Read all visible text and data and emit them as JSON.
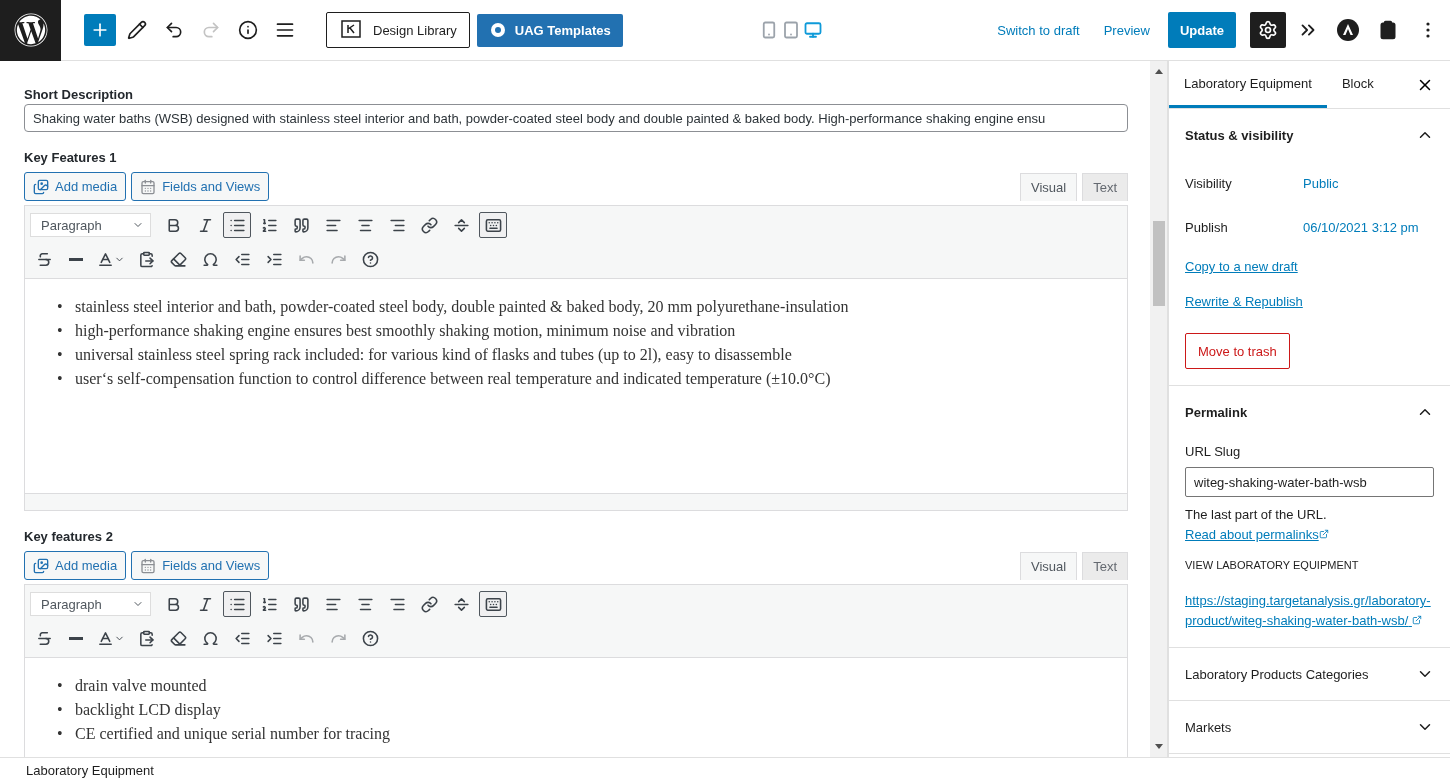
{
  "top_bar": {
    "tools": [
      {
        "kind": "add",
        "disabled": false
      },
      {
        "kind": "edit",
        "disabled": false
      },
      {
        "kind": "undo",
        "disabled": false
      },
      {
        "kind": "redo",
        "disabled": true
      },
      {
        "kind": "info",
        "disabled": false
      },
      {
        "kind": "list-view",
        "disabled": false
      }
    ],
    "design_library": "Design Library",
    "uag_templates": "UAG Templates",
    "preview_devices": [
      {
        "kind": "mobile",
        "selected": false
      },
      {
        "kind": "tablet",
        "selected": false
      },
      {
        "kind": "desktop",
        "selected": true
      }
    ],
    "switch_to_draft": "Switch to draft",
    "preview": "Preview",
    "update": "Update",
    "plugins": [
      {
        "kind": "settings",
        "selected": true
      },
      {
        "kind": "spectra",
        "selected": false
      },
      {
        "kind": "astra",
        "selected": false
      },
      {
        "kind": "clipboard",
        "selected": false
      },
      {
        "kind": "more",
        "selected": false
      }
    ]
  },
  "short_description": {
    "label": "Short Description",
    "value": "Shaking water baths (WSB) designed with stainless steel interior and bath, powder-coated steel body and double painted & baked body. High-performance shaking engine ensu"
  },
  "editors": [
    {
      "label": "Key Features 1",
      "marker": "•",
      "buttons": [
        "Add media",
        "Fields and Views"
      ],
      "tabs": [
        {
          "label": "Visual",
          "selected": true
        },
        {
          "label": "Text",
          "selected": false
        }
      ],
      "format": "Paragraph",
      "toolbar_rows": [
        [
          {
            "kind": "bold",
            "pressed": false,
            "disabled": false
          },
          {
            "kind": "italic",
            "pressed": false,
            "disabled": false
          },
          {
            "kind": "bullets",
            "pressed": true,
            "disabled": false
          },
          {
            "kind": "numbers",
            "pressed": false,
            "disabled": false
          },
          {
            "kind": "quote",
            "pressed": false,
            "disabled": false
          },
          {
            "kind": "align-left",
            "pressed": false,
            "disabled": false
          },
          {
            "kind": "align-center",
            "pressed": false,
            "disabled": false
          },
          {
            "kind": "align-right",
            "pressed": false,
            "disabled": false
          },
          {
            "kind": "link",
            "pressed": false,
            "disabled": false
          },
          {
            "kind": "more",
            "pressed": false,
            "disabled": false
          },
          {
            "kind": "toolbar-toggle",
            "pressed": true,
            "disabled": false
          }
        ],
        [
          {
            "kind": "strike",
            "pressed": false,
            "disabled": false
          },
          {
            "kind": "hr",
            "pressed": false,
            "disabled": false
          },
          {
            "kind": "text-color",
            "pressed": false,
            "disabled": false
          },
          {
            "kind": "paste",
            "pressed": false,
            "disabled": false
          },
          {
            "kind": "eraser",
            "pressed": false,
            "disabled": false
          },
          {
            "kind": "omega",
            "pressed": false,
            "disabled": false
          },
          {
            "kind": "outdent",
            "pressed": false,
            "disabled": false
          },
          {
            "kind": "indent",
            "pressed": false,
            "disabled": false
          },
          {
            "kind": "undo",
            "pressed": false,
            "disabled": true
          },
          {
            "kind": "redo",
            "pressed": false,
            "disabled": true
          },
          {
            "kind": "help",
            "pressed": false,
            "disabled": false
          }
        ]
      ],
      "items": [
        "stainless steel interior and bath, powder-coated steel body, double painted & baked body, 20 mm polyurethane-insulation",
        "high-performance shaking engine ensures best smoothly shaking motion, minimum noise and vibration",
        "universal stainless steel spring rack included: for various kind of flasks and tubes (up to 2l), easy to disassemble",
        "user‘s self-compensation function to control difference between real temperature and indicated temperature (±10.0°C)"
      ]
    },
    {
      "label": "Key features 2",
      "marker": "•",
      "buttons": [
        "Add media",
        "Fields and Views"
      ],
      "tabs": [
        {
          "label": "Visual",
          "selected": true
        },
        {
          "label": "Text",
          "selected": false
        }
      ],
      "format": "Paragraph",
      "toolbar_rows": [
        [
          {
            "kind": "bold",
            "pressed": false,
            "disabled": false
          },
          {
            "kind": "italic",
            "pressed": false,
            "disabled": false
          },
          {
            "kind": "bullets",
            "pressed": true,
            "disabled": false
          },
          {
            "kind": "numbers",
            "pressed": false,
            "disabled": false
          },
          {
            "kind": "quote",
            "pressed": false,
            "disabled": false
          },
          {
            "kind": "align-left",
            "pressed": false,
            "disabled": false
          },
          {
            "kind": "align-center",
            "pressed": false,
            "disabled": false
          },
          {
            "kind": "align-right",
            "pressed": false,
            "disabled": false
          },
          {
            "kind": "link",
            "pressed": false,
            "disabled": false
          },
          {
            "kind": "more",
            "pressed": false,
            "disabled": false
          },
          {
            "kind": "toolbar-toggle",
            "pressed": true,
            "disabled": false
          }
        ],
        [
          {
            "kind": "strike",
            "pressed": false,
            "disabled": false
          },
          {
            "kind": "hr",
            "pressed": false,
            "disabled": false
          },
          {
            "kind": "text-color",
            "pressed": false,
            "disabled": false
          },
          {
            "kind": "paste",
            "pressed": false,
            "disabled": false
          },
          {
            "kind": "eraser",
            "pressed": false,
            "disabled": false
          },
          {
            "kind": "omega",
            "pressed": false,
            "disabled": false
          },
          {
            "kind": "outdent",
            "pressed": false,
            "disabled": false
          },
          {
            "kind": "indent",
            "pressed": false,
            "disabled": false
          },
          {
            "kind": "undo",
            "pressed": false,
            "disabled": true
          },
          {
            "kind": "redo",
            "pressed": false,
            "disabled": true
          },
          {
            "kind": "help",
            "pressed": false,
            "disabled": false
          }
        ]
      ],
      "items": [
        "drain valve mounted",
        "backlight LCD display",
        "CE certified and unique serial number for tracing"
      ]
    }
  ],
  "sidebar": {
    "tabs": [
      {
        "label": "Laboratory Equipment",
        "selected": true
      },
      {
        "label": "Block",
        "selected": false
      }
    ],
    "status": {
      "title": "Status & visibility",
      "expanded": true,
      "rows": [
        {
          "label": "Visibility",
          "value": "Public"
        },
        {
          "label": "Publish",
          "value": "06/10/2021 3:12 pm"
        }
      ],
      "links": [
        "Copy to a new draft",
        "Rewrite & Republish"
      ],
      "trash": "Move to trash"
    },
    "permalink": {
      "title": "Permalink",
      "expanded": true,
      "slug_label": "URL Slug",
      "slug": "witeg-shaking-water-bath-wsb",
      "help": "The last part of the URL.",
      "help_link": "Read about permalinks",
      "view_label": "VIEW LABORATORY EQUIPMENT",
      "url_prefix": "https://staging.targetanalysis.gr/laboratory-product/",
      "url_slug": "witeg-shaking-water-bath-wsb/"
    },
    "panels": [
      {
        "title": "Laboratory Products Categories",
        "expanded": false
      },
      {
        "title": "Markets",
        "expanded": false
      }
    ]
  },
  "footer": {
    "breadcrumb": "Laboratory Equipment"
  }
}
